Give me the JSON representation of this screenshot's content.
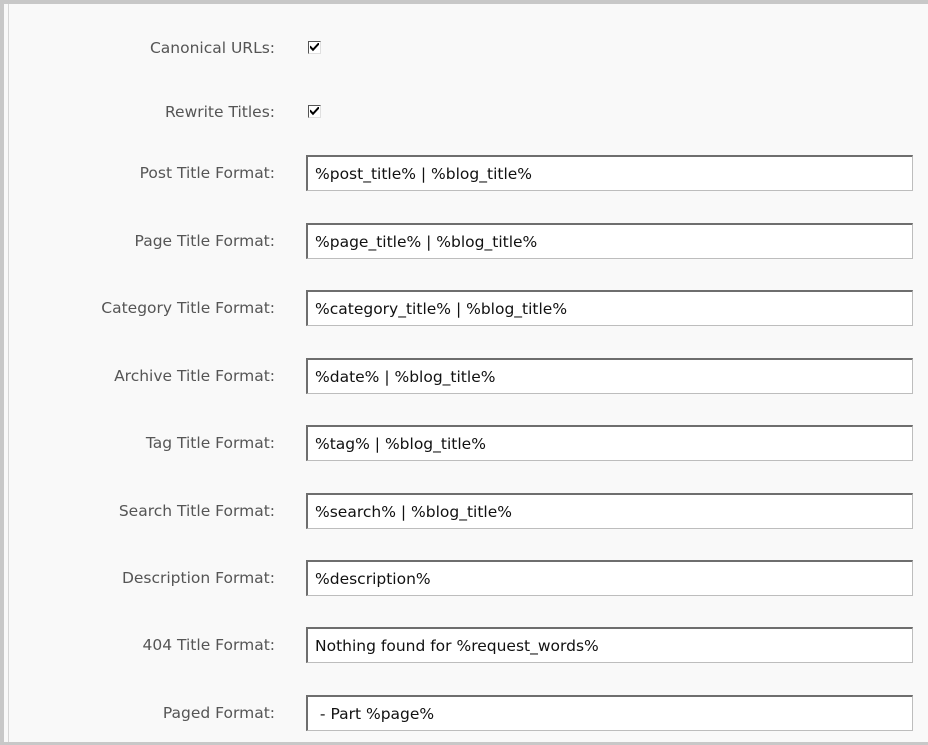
{
  "settings": {
    "canonical_urls": {
      "label": "Canonical URLs:",
      "checked": true
    },
    "rewrite_titles": {
      "label": "Rewrite Titles:",
      "checked": true
    },
    "post_title_format": {
      "label": "Post Title Format:",
      "value": "%post_title% | %blog_title%"
    },
    "page_title_format": {
      "label": "Page Title Format:",
      "value": "%page_title% | %blog_title%"
    },
    "category_title_format": {
      "label": "Category Title Format:",
      "value": "%category_title% | %blog_title%"
    },
    "archive_title_format": {
      "label": "Archive Title Format:",
      "value": "%date% | %blog_title%"
    },
    "tag_title_format": {
      "label": "Tag Title Format:",
      "value": "%tag% | %blog_title%"
    },
    "search_title_format": {
      "label": "Search Title Format:",
      "value": "%search% | %blog_title%"
    },
    "description_format": {
      "label": "Description Format:",
      "value": "%description%"
    },
    "title_404_format": {
      "label": "404 Title Format:",
      "value": "Nothing found for %request_words%"
    },
    "paged_format": {
      "label": "Paged Format:",
      "value": " - Part %page%"
    }
  },
  "colors": {
    "background": "#f9f9f9",
    "label_text": "#555555",
    "input_border_dark": "#6e6e6e",
    "frame_border": "#c8c8c8"
  },
  "icons": {
    "checkbox_mark": "checkmark-icon"
  }
}
